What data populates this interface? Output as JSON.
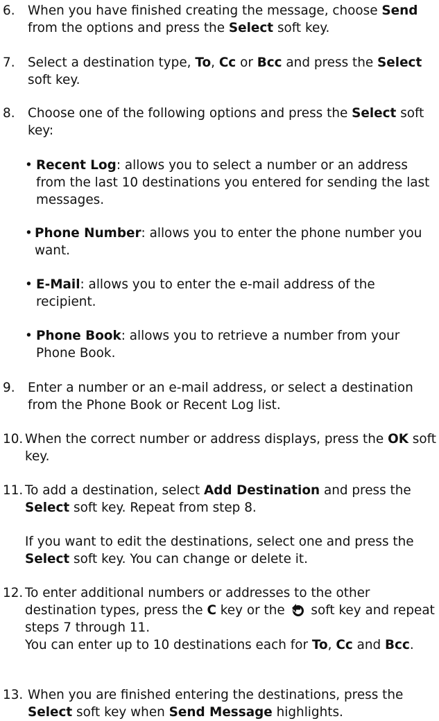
{
  "steps": {
    "s6": {
      "num": "6.",
      "parts": [
        "When you have finished creating the message, choose ",
        "Send",
        " from the options and press the ",
        "Select",
        " soft key."
      ]
    },
    "s7": {
      "num": "7.",
      "parts": [
        "Select a destination type, ",
        "To",
        ", ",
        "Cc",
        " or ",
        "Bcc",
        " and press the ",
        "Select",
        " soft key."
      ]
    },
    "s8": {
      "num": "8.",
      "parts": [
        "Choose one of the following options and press the ",
        "Select",
        " soft key:"
      ]
    },
    "bullets": [
      {
        "dot": "•",
        "term": "Recent Log",
        "text": ": allows you to select a number or an address from the last 10 destinations you entered for sending the last messages."
      },
      {
        "dot": "•",
        "term": "Phone Number",
        "text": ": allows you to enter the phone number you want."
      },
      {
        "dot": "•",
        "term": "E-Mail",
        "text": ": allows you to enter the e-mail address of the recipient."
      },
      {
        "dot": "•",
        "term": "Phone Book",
        "text": ": allows you to retrieve a number from your Phone Book."
      }
    ],
    "s9": {
      "num": "9.",
      "text": "Enter a number or an e-mail address, or select a destination from the Phone Book or Recent Log list."
    },
    "s10": {
      "num": "10.",
      "parts": [
        "When the correct number or address displays, press the ",
        "OK",
        " soft key."
      ]
    },
    "s11": {
      "num": "11.",
      "parts": [
        "To add a destination, select ",
        "Add Destination",
        " and press the ",
        "Select",
        " soft key. Repeat from step 8."
      ],
      "note_parts": [
        "If you want to edit the destinations, select one and press the ",
        "Select",
        " soft key. You can change or delete it."
      ]
    },
    "s12": {
      "num": "12.",
      "parts": [
        "To enter additional numbers or addresses to the other destination types, press the ",
        "C",
        " key or the ",
        " soft key and repeat steps 7 through 11."
      ],
      "icon": "back-arrow-icon",
      "note_parts": [
        "You can enter up to 10 destinations each for ",
        "To",
        ", ",
        "Cc",
        " and ",
        "Bcc",
        "."
      ]
    },
    "s13": {
      "num": "13.",
      "parts": [
        "When you are finished entering the destinations, press the ",
        "Select",
        " soft key when ",
        "Send Message",
        " highlights."
      ]
    }
  }
}
